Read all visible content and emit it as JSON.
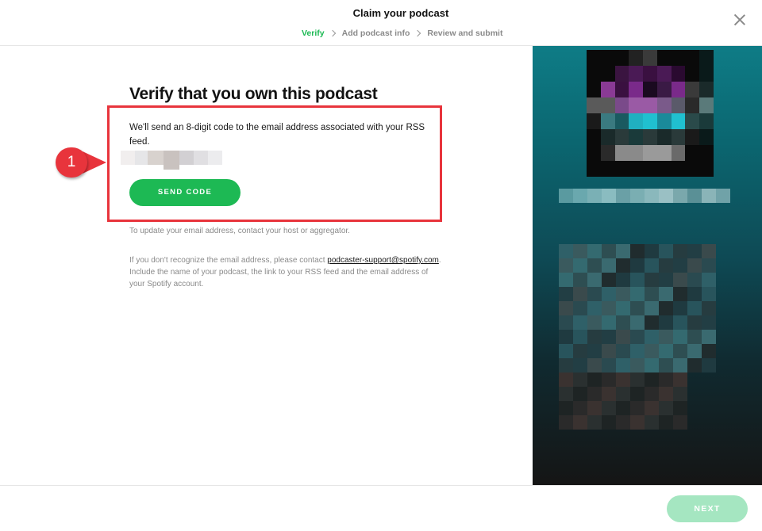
{
  "header": {
    "title": "Claim your podcast",
    "steps": [
      {
        "label": "Verify",
        "active": true
      },
      {
        "label": "Add podcast info",
        "active": false
      },
      {
        "label": "Review and submit",
        "active": false
      }
    ],
    "close_icon": "close-icon"
  },
  "main": {
    "heading": "Verify that you own this podcast",
    "description": "We'll send an 8-digit code to the email address associated with your RSS feed.",
    "send_code_label": "SEND CODE",
    "update_note": "To update your email address, contact your host or aggregator.",
    "support_prefix": "If you don't recognize the email address, please contact ",
    "support_link": "podcaster-support@spotify.com",
    "support_suffix": ". Include the name of your podcast, the link to your RSS feed and the email address of your Spotify account."
  },
  "annotation": {
    "number": "1",
    "color": "#e8343c"
  },
  "footer": {
    "next_label": "NEXT"
  },
  "colors": {
    "accent": "#1db954",
    "accent_disabled": "#a5e6c1",
    "annotation_red": "#e8343c"
  }
}
